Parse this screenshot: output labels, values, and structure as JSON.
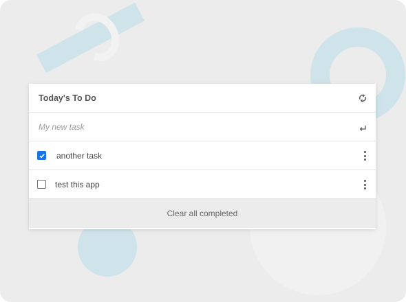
{
  "colors": {
    "background": "#ececec",
    "decor_blue": "#cfe3ea",
    "decor_light": "#f1f1f1",
    "card": "#ffffff",
    "footer": "#ececec",
    "checkbox_checked": "#1a73e8",
    "text": "#444444"
  },
  "header": {
    "title": "Today's To Do",
    "sync_icon": "sync-icon"
  },
  "new_task": {
    "placeholder": "My new task",
    "value": "",
    "enter_icon": "enter-icon"
  },
  "tasks": [
    {
      "label": "another task",
      "completed": true,
      "menu_icon": "kebab-menu-icon"
    },
    {
      "label": "test this app",
      "completed": false,
      "menu_icon": "kebab-menu-icon"
    }
  ],
  "footer": {
    "clear_label": "Clear all completed"
  }
}
